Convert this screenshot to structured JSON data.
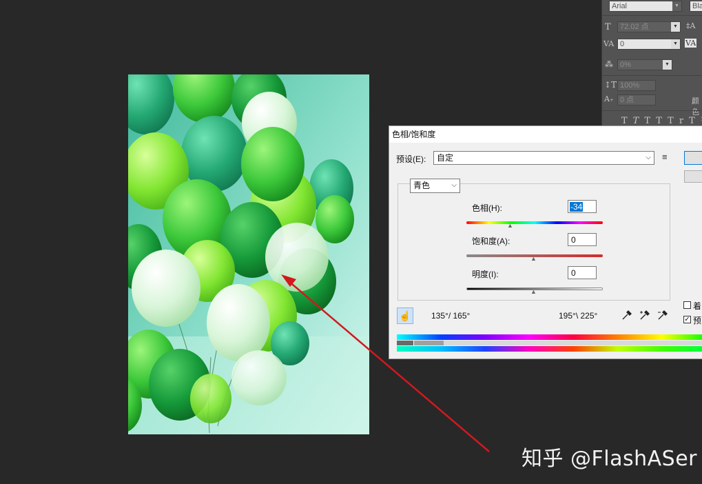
{
  "character_panel": {
    "font_family_value": "Arial",
    "font_style_value": "Bla",
    "font_size": "72.02 点",
    "kerning": "0",
    "tracking": "0%",
    "vertical_scale": "100%",
    "baseline_shift": "0 点",
    "color_label": "颜色",
    "type_style_icons": [
      "T",
      "T",
      "TT",
      "Tr",
      "T¹"
    ]
  },
  "dialog": {
    "title": "色相/饱和度",
    "preset_label": "预设(E):",
    "preset_value": "自定",
    "channel_value": "青色",
    "hue_label": "色相(H):",
    "hue_value": "-34",
    "saturation_label": "饱和度(A):",
    "saturation_value": "0",
    "lightness_label": "明度(I):",
    "lightness_value": "0",
    "range_left": "135°/ 165°",
    "range_right": "195°\\ 225°",
    "colorize_label": "着",
    "preview_label": "预",
    "slider_positions": {
      "hue": 0.33,
      "saturation": 0.5,
      "lightness": 0.5
    }
  },
  "watermark": "知乎 @FlashASer",
  "colors": {
    "background": "#282828",
    "panel": "#535353",
    "dialog": "#f0f0f0",
    "arrow": "#d2191e",
    "accent": "#0078d7"
  }
}
